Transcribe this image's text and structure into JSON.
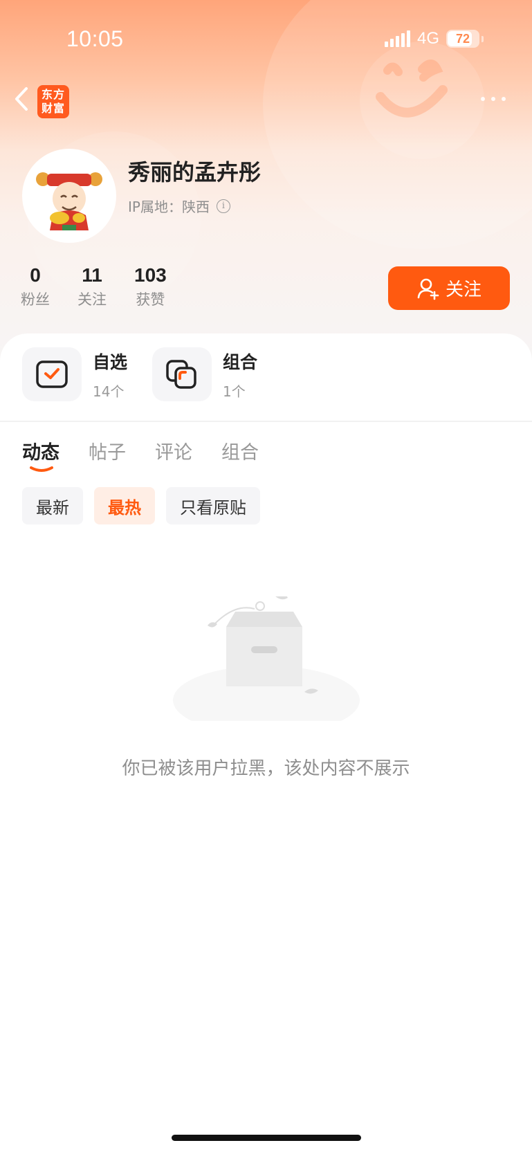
{
  "status_bar": {
    "time": "10:05",
    "network": "4G",
    "battery": "72"
  },
  "nav": {
    "logo_line1": "东方",
    "logo_line2": "财富"
  },
  "profile": {
    "username": "秀丽的孟卉彤",
    "ip_label": "IP属地：陕西",
    "info_glyph": "i"
  },
  "stats": [
    {
      "num": "0",
      "label": "粉丝"
    },
    {
      "num": "11",
      "label": "关注"
    },
    {
      "num": "103",
      "label": "获赞"
    }
  ],
  "follow_button": {
    "label": "关注"
  },
  "shortcuts": [
    {
      "title": "自选",
      "count": "14个",
      "icon": "watchlist-icon"
    },
    {
      "title": "组合",
      "count": "1个",
      "icon": "portfolio-icon"
    }
  ],
  "tabs": [
    {
      "label": "动态",
      "active": true
    },
    {
      "label": "帖子",
      "active": false
    },
    {
      "label": "评论",
      "active": false
    },
    {
      "label": "组合",
      "active": false
    }
  ],
  "filters": [
    {
      "label": "最新",
      "active": false
    },
    {
      "label": "最热",
      "active": true
    },
    {
      "label": "只看原贴",
      "active": false
    }
  ],
  "empty_state": {
    "message": "你已被该用户拉黑，该处内容不展示"
  },
  "colors": {
    "accent": "#ff5a10",
    "chip_active_bg": "#ffeee5"
  }
}
